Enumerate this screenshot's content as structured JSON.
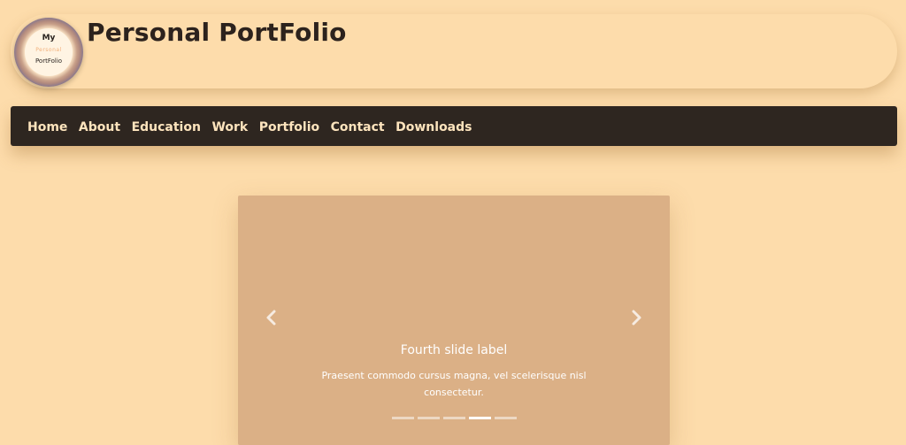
{
  "header": {
    "logo_line1": "My",
    "logo_line2": "Personal",
    "logo_line3": "PortFolio",
    "title": "Personal PortFolio"
  },
  "nav": {
    "items": [
      {
        "label": "Home"
      },
      {
        "label": "About"
      },
      {
        "label": "Education"
      },
      {
        "label": "Work"
      },
      {
        "label": "Portfolio"
      },
      {
        "label": "Contact"
      },
      {
        "label": "Downloads"
      }
    ]
  },
  "carousel": {
    "slide_label": "Fourth slide label",
    "slide_text": "Praesent commodo cursus magna, vel scelerisque nisl consectetur.",
    "slide_count": 5,
    "active_index": 3,
    "prev_icon": "chevron-left-icon",
    "next_icon": "chevron-right-icon"
  },
  "colors": {
    "background": "#fddcab",
    "navbar": "#2e2620",
    "nav_text": "#fde4bd",
    "slide_bg": "#dbb086",
    "title_text": "#2c221d"
  }
}
